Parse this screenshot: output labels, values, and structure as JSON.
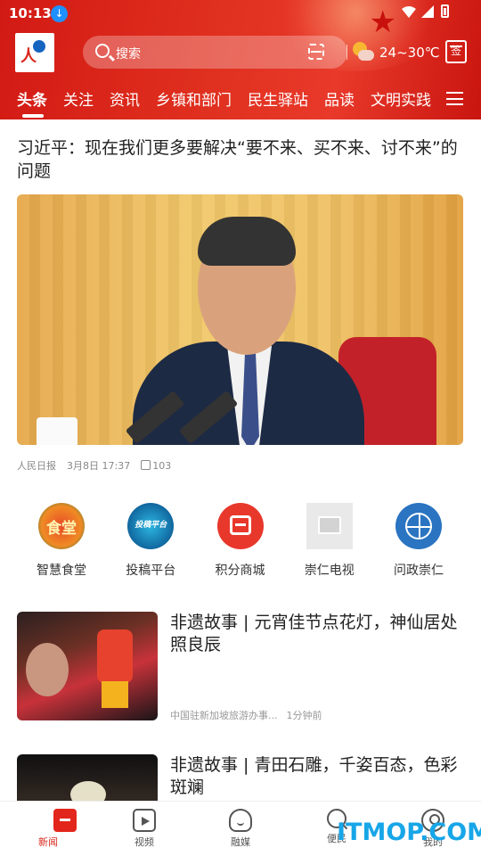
{
  "status_bar": {
    "time": "10:13"
  },
  "header": {
    "search_placeholder": "搜索",
    "weather_temp": "24~30℃",
    "sign_label": "签",
    "tabs": [
      {
        "label": "头条",
        "active": true
      },
      {
        "label": "关注"
      },
      {
        "label": "资讯"
      },
      {
        "label": "乡镇和部门"
      },
      {
        "label": "民生驿站"
      },
      {
        "label": "品读"
      },
      {
        "label": "文明实践"
      }
    ]
  },
  "headline": {
    "title": "习近平：现在我们更多要解决“要不来、买不来、讨不来”的问题",
    "source": "人民日报",
    "time": "3月8日 17:37",
    "likes": "103"
  },
  "quick_entries": [
    {
      "label": "智慧食堂",
      "icon": "canteen-icon",
      "badge": "食堂"
    },
    {
      "label": "投稿平台",
      "icon": "submit-icon",
      "badge": "投稿平台"
    },
    {
      "label": "积分商城",
      "icon": "shop-icon"
    },
    {
      "label": "崇仁电视",
      "icon": "image-placeholder-icon"
    },
    {
      "label": "问政崇仁",
      "icon": "globe-icon"
    }
  ],
  "news": [
    {
      "title": "非遗故事 | 元宵佳节点花灯，神仙居处照良辰",
      "source": "中国驻新加坡旅游办事...",
      "time": "1分钟前"
    },
    {
      "title": "非遗故事 | 青田石雕，千姿百态，色彩斑斓"
    }
  ],
  "bottom_nav": [
    {
      "label": "新闻",
      "active": true
    },
    {
      "label": "视频"
    },
    {
      "label": "融媒"
    },
    {
      "label": "便民"
    },
    {
      "label": "我的"
    }
  ],
  "watermark": "ITMOP.COM",
  "colors": {
    "brand_red": "#d9261c",
    "watermark_blue": "#17a6e8"
  }
}
